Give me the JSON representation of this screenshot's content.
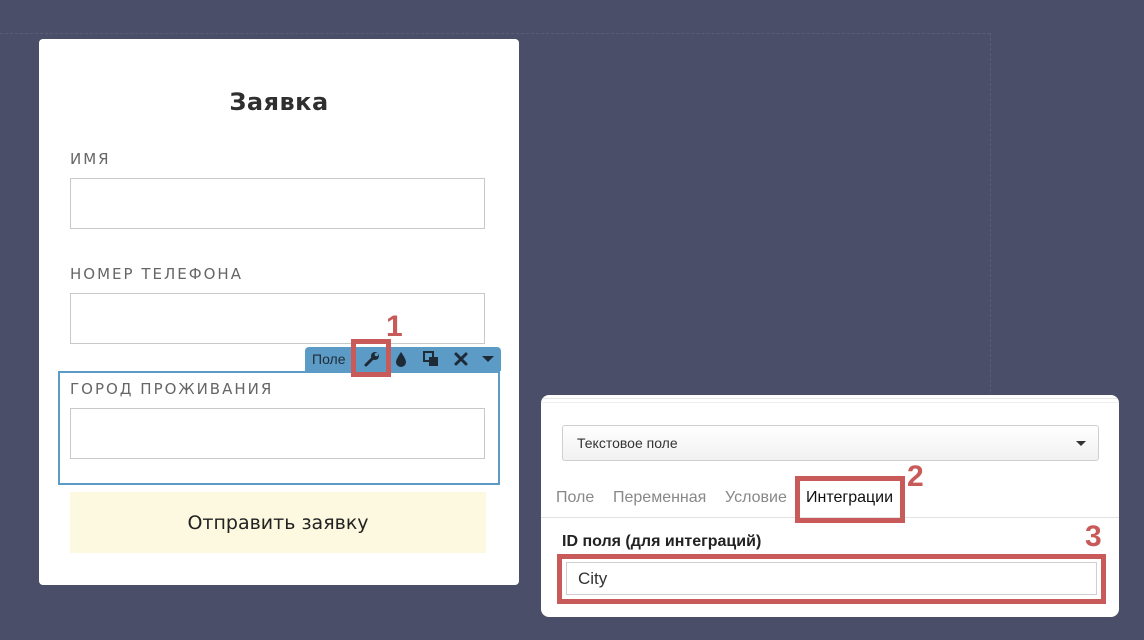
{
  "form": {
    "title": "Заявка",
    "fields": [
      {
        "label": "ИМЯ",
        "value": ""
      },
      {
        "label": "НОМЕР ТЕЛЕФОНА",
        "value": ""
      },
      {
        "label": "ГОРОД ПРОЖИВАНИЯ",
        "value": ""
      }
    ],
    "submit_label": "Отправить заявку"
  },
  "toolbar": {
    "label": "Поле",
    "icons": [
      "wrench-icon",
      "drop-icon",
      "duplicate-icon",
      "close-icon",
      "chevron-down-icon"
    ]
  },
  "settings": {
    "type_select": "Текстовое поле",
    "tabs": [
      "Поле",
      "Переменная",
      "Условие",
      "Интеграции"
    ],
    "active_tab": "Интеграции",
    "id_label": "ID поля (для интеграций)",
    "id_value": "City"
  },
  "markers": [
    "1",
    "2",
    "3"
  ],
  "colors": {
    "background": "#4b4e69",
    "accent": "#5b9bc6",
    "highlight": "#c85a5a",
    "submit_bg": "#fdf9e0"
  }
}
